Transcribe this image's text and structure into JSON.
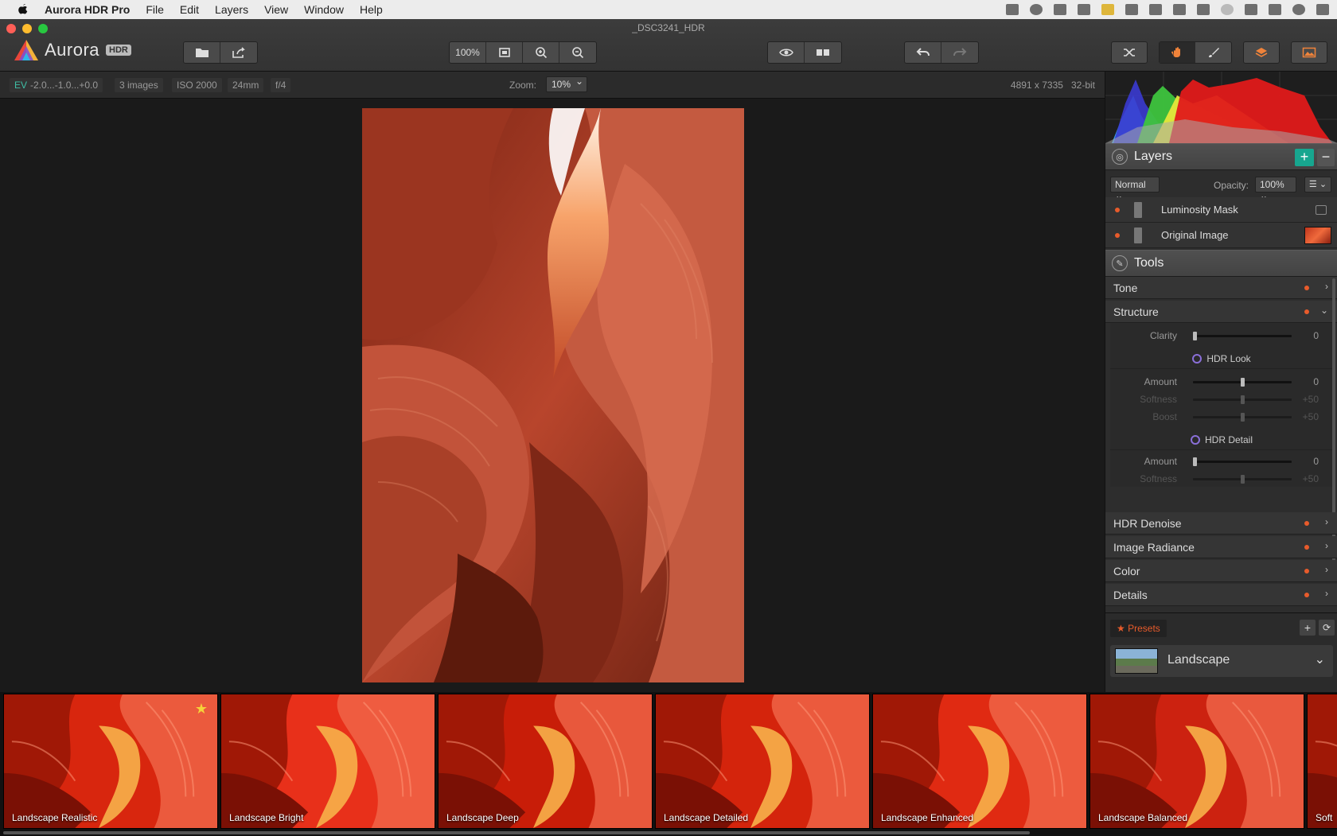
{
  "menubar": {
    "app_name": "Aurora HDR Pro",
    "items": [
      "File",
      "Edit",
      "Layers",
      "View",
      "Window",
      "Help"
    ]
  },
  "window": {
    "title": "_DSC3241_HDR"
  },
  "logo": {
    "text": "Aurora",
    "badge": "HDR"
  },
  "toolbar": {
    "zoom_100_label": "100%",
    "icons": [
      "folder-icon",
      "share-icon",
      "fit-screen-icon",
      "zoom-in-icon",
      "zoom-out-icon",
      "eye-icon",
      "compare-icon",
      "undo-icon",
      "redo-icon",
      "shuffle-icon",
      "hand-icon",
      "brush-icon",
      "layers-icon",
      "image-icon"
    ]
  },
  "infobar": {
    "ev_label": "EV",
    "ev_value": "-2.0...-1.0...+0.0",
    "images": "3 images",
    "iso": "ISO 2000",
    "focal": "24mm",
    "aperture": "f/4",
    "zoom_label": "Zoom:",
    "zoom_value": "10%",
    "dimensions": "4891 x 7335",
    "bit_depth": "32-bit"
  },
  "layers": {
    "title": "Layers",
    "add_label": "+",
    "remove_label": "−",
    "blend_mode": "Normal",
    "opacity_label": "Opacity:",
    "opacity_value": "100%",
    "items": [
      {
        "name": "Luminosity Mask"
      },
      {
        "name": "Original Image"
      }
    ]
  },
  "tools": {
    "title": "Tools",
    "tone": "Tone",
    "structure": "Structure",
    "clarity_label": "Clarity",
    "clarity_value": "0",
    "hdr_look": {
      "title": "HDR Look",
      "amount_label": "Amount",
      "amount_value": "0",
      "softness_label": "Softness",
      "softness_value": "+50",
      "boost_label": "Boost",
      "boost_value": "+50"
    },
    "hdr_detail": {
      "title": "HDR Detail",
      "amount_label": "Amount",
      "amount_value": "0",
      "softness_label": "Softness",
      "softness_value": "+50"
    },
    "more": [
      "HDR Denoise",
      "Image Radiance",
      "Color",
      "Details"
    ]
  },
  "presets": {
    "tab_label": "★ Presets",
    "add_label": "+",
    "category": "Landscape",
    "items": [
      {
        "name": "Landscape Realistic",
        "starred": true
      },
      {
        "name": "Landscape Bright"
      },
      {
        "name": "Landscape Deep"
      },
      {
        "name": "Landscape Detailed"
      },
      {
        "name": "Landscape Enhanced"
      },
      {
        "name": "Landscape Balanced"
      },
      {
        "name": "Soft"
      }
    ]
  },
  "colors": {
    "accent_teal": "#17a68f",
    "accent_orange": "#e85b2b",
    "panel": "#2d2d2d"
  }
}
